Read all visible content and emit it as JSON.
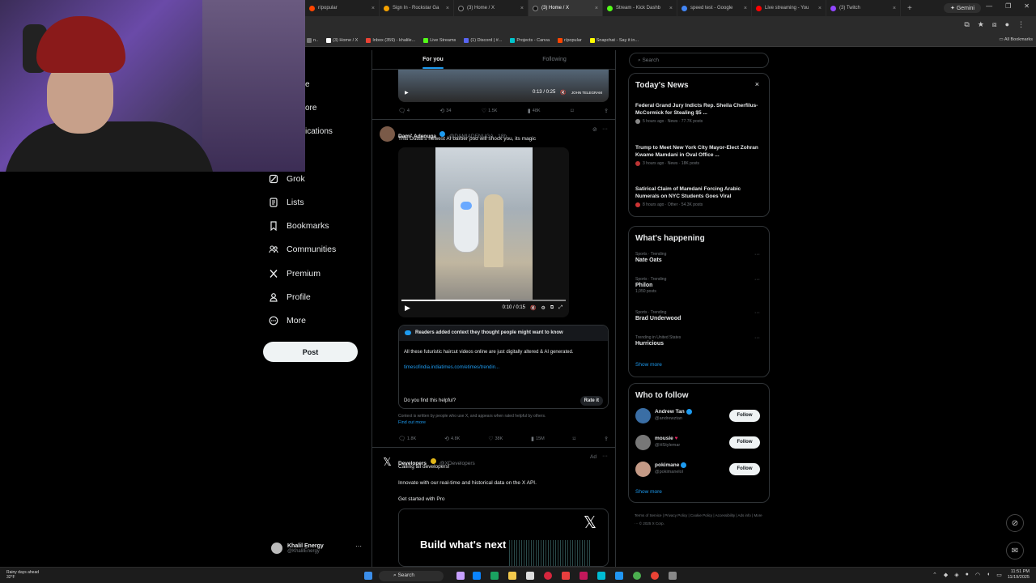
{
  "browser": {
    "tabs": [
      {
        "label": "r/popular",
        "color": "#ff4500",
        "active": false
      },
      {
        "label": "Sign In - Rockstar Ga",
        "color": "#f4a100",
        "active": false
      },
      {
        "label": "(3) Home / X",
        "color": "#111111",
        "active": false
      },
      {
        "label": "(3) Home / X",
        "color": "#111111",
        "active": true
      },
      {
        "label": "Stream - Kick Dashb",
        "color": "#53fc18",
        "active": false
      },
      {
        "label": "speed test - Google",
        "color": "#4285f4",
        "active": false
      },
      {
        "label": "Live streaming - You",
        "color": "#ff0000",
        "active": false
      },
      {
        "label": "(3) Twitch",
        "color": "#9146ff",
        "active": false
      }
    ],
    "new_tab": "+",
    "gemini": "Gemini",
    "bookmarks": [
      {
        "label": "n..",
        "color": "#777777"
      },
      {
        "label": "(3) Home / X",
        "color": "#ffffff"
      },
      {
        "label": "Inbox (359) - khalile...",
        "color": "#ea4335"
      },
      {
        "label": "Live Streams",
        "color": "#53fc18"
      },
      {
        "label": "(1) Discord | #...",
        "color": "#5865f2"
      },
      {
        "label": "Projects - Canva",
        "color": "#00c4cc"
      },
      {
        "label": "r/popular",
        "color": "#ff4500"
      },
      {
        "label": "Snapchat - Say it in...",
        "color": "#fffc00"
      }
    ],
    "all_bookmarks": "All Bookmarks"
  },
  "nav": {
    "fragments": [
      "e",
      "ore",
      "ications"
    ],
    "items": [
      {
        "label": "Grok",
        "icon": "grok-icon"
      },
      {
        "label": "Lists",
        "icon": "lists-icon"
      },
      {
        "label": "Bookmarks",
        "icon": "bookmark-icon"
      },
      {
        "label": "Communities",
        "icon": "communities-icon"
      },
      {
        "label": "Premium",
        "icon": "x-logo-icon"
      },
      {
        "label": "Profile",
        "icon": "profile-icon"
      },
      {
        "label": "More",
        "icon": "more-icon"
      }
    ],
    "post_label": "Post",
    "account": {
      "name": "Khalil Energy",
      "handle": "@KhalilEnergy",
      "menu": "···"
    }
  },
  "feed": {
    "tabs": [
      "For you",
      "Following"
    ],
    "video1": {
      "time": "0:13 / 0:25",
      "watermark": "JOHN TELEGRAM"
    },
    "post1_actions": {
      "replies": "4",
      "reposts": "34",
      "likes": "1.5K",
      "views": "48K"
    },
    "post2": {
      "name": "Dami' Adenuga",
      "handle": "@DAMIADENUGA · 18h",
      "text": "This Dubai's newest AI barber pod will shock you, its magic",
      "video_time": "0:10 / 0:15",
      "video_progress": 0.66,
      "note": {
        "header": "Readers added context they thought people might want to know",
        "body": "All these futuristic haircut videos online are just digitally altered & AI generated.",
        "link": "timesofindia.indiatimes.com/etimes/trendin...",
        "question": "Do you find this helpful?",
        "rate": "Rate it"
      },
      "disclaimer": "Context is written by people who use X, and appears when rated helpful by others.",
      "find_out_more": "Find out more",
      "actions": {
        "replies": "1.8K",
        "reposts": "4.8K",
        "likes": "38K",
        "views": "15M"
      }
    },
    "post3": {
      "name": "Developers",
      "handle": "@XDevelopers",
      "ad": "Ad",
      "line1": "Calling all developers!",
      "line2": "Innovate with our real-time and historical data on the X API.",
      "line3": "Get started with Pro",
      "card_text": "Build what's next"
    }
  },
  "right": {
    "search_placeholder": "Search",
    "todays_news": {
      "title": "Today's News",
      "items": [
        {
          "title": "Federal Grand Jury Indicts Rep. Sheila Cherfilus-McCormick for Stealing $5 ...",
          "meta": "5 hours ago · News · 77.7K posts"
        },
        {
          "title": "Trump to Meet New York City Mayor-Elect Zohran Kwame Mamdani in Oval Office ...",
          "meta": "3 hours ago · News · 18K posts"
        },
        {
          "title": "Satirical Claim of Mamdani Forcing Arabic Numerals on NYC Students Goes Viral",
          "meta": "8 hours ago · Other · 54.3K posts"
        }
      ]
    },
    "happening": {
      "title": "What's happening",
      "items": [
        {
          "category": "Sports · Trending",
          "name": "Nate Oats",
          "posts": ""
        },
        {
          "category": "Sports · Trending",
          "name": "Philon",
          "posts": "1,050 posts"
        },
        {
          "category": "Sports · Trending",
          "name": "Brad Underwood",
          "posts": ""
        },
        {
          "category": "Trending in United States",
          "name": "Hurricious",
          "posts": ""
        }
      ],
      "show_more": "Show more"
    },
    "who_to_follow": {
      "title": "Who to follow",
      "items": [
        {
          "name": "Andrew Tan",
          "handle": "@andrewztan",
          "avatar": "#3a6ea5"
        },
        {
          "name": "mousie",
          "handle": "@HStylemar",
          "avatar": "#777777"
        },
        {
          "name": "pokimane",
          "handle": "@pokimanelol",
          "avatar": "#c49a86"
        }
      ],
      "follow_label": "Follow",
      "show_more": "Show more"
    },
    "footer": [
      "Terms of Service",
      "Privacy Policy",
      "Cookie Policy",
      "Accessibility",
      "Ads info",
      "More ···",
      "© 2025 X Corp."
    ]
  },
  "taskbar": {
    "weather_line1": "Rainy days ahead",
    "weather_line2": "32°F",
    "search": "Search",
    "time": "11:51 PM",
    "date": "11/19/2025"
  }
}
